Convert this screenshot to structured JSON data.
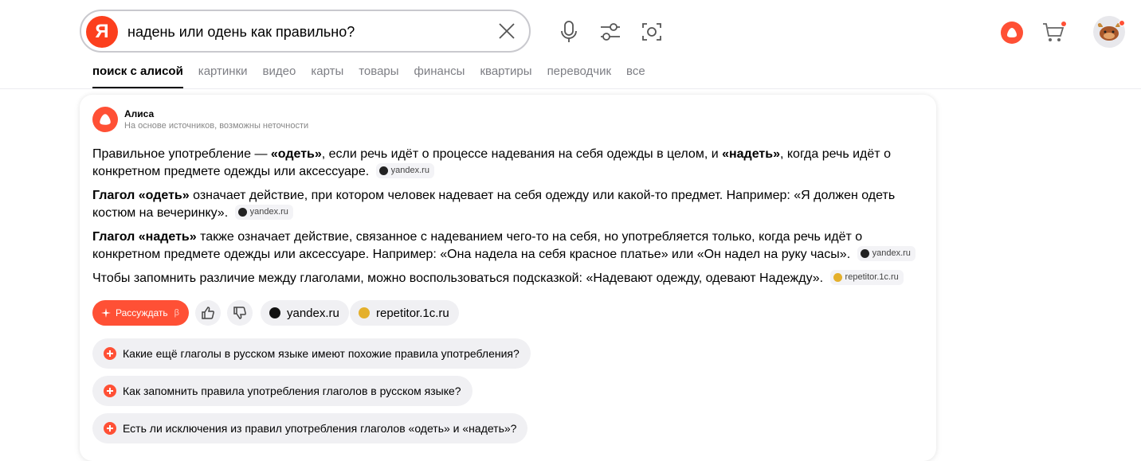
{
  "search": {
    "logo": "Я",
    "query": "надень или одень как правильно?"
  },
  "tabs": [
    {
      "label": "поиск с алисой",
      "active": true
    },
    {
      "label": "картинки"
    },
    {
      "label": "видео"
    },
    {
      "label": "карты"
    },
    {
      "label": "товары"
    },
    {
      "label": "финансы"
    },
    {
      "label": "квартиры"
    },
    {
      "label": "переводчик"
    },
    {
      "label": "все"
    }
  ],
  "colors": {
    "brand": "#fc3f1d",
    "alice": "#ff5035",
    "chip_bg": "#f0f0f3"
  },
  "answer": {
    "author": "Алиса",
    "disclaimer": "На основе источников, возможны неточности",
    "paragraphs": [
      {
        "p1": "Правильное употребление — ",
        "b1": "«одеть»",
        "p2": ", если речь идёт о процессе надевания на себя одежды в целом, и ",
        "b2": "«надеть»",
        "p3": ", когда речь идёт о конкретном предмете одежды или аксессуаре.",
        "source": "yandex.ru"
      },
      {
        "b1": "Глагол «одеть»",
        "p1": " означает действие, при котором человек надевает на себя одежду или какой-то предмет. Например: «Я должен одеть костюм на вечеринку».",
        "source": "yandex.ru"
      },
      {
        "b1": "Глагол «надеть»",
        "p1": " также означает действие, связанное с надеванием чего-то на себя, но употребляется только, когда речь идёт о конкретном предмете одежды или аксессуаре. Например: «Она надела на себя красное платье» или «Он надел на руку часы».",
        "source": "yandex.ru"
      },
      {
        "p1": "Чтобы запомнить различие между глаголами, можно воспользоваться подсказкой: «Надевают одежду, одевают Надежду».",
        "source": "repetitor.1c.ru"
      }
    ]
  },
  "actions": {
    "reason_label": "Рассуждать",
    "beta": "β",
    "sources": [
      "yandex.ru",
      "repetitor.1c.ru"
    ]
  },
  "suggestions": [
    "Какие ещё глаголы в русском языке имеют похожие правила употребления?",
    "Как запомнить правила употребления глаголов в русском языке?",
    "Есть ли исключения из правил употребления глаголов «одеть» и «надеть»?"
  ]
}
